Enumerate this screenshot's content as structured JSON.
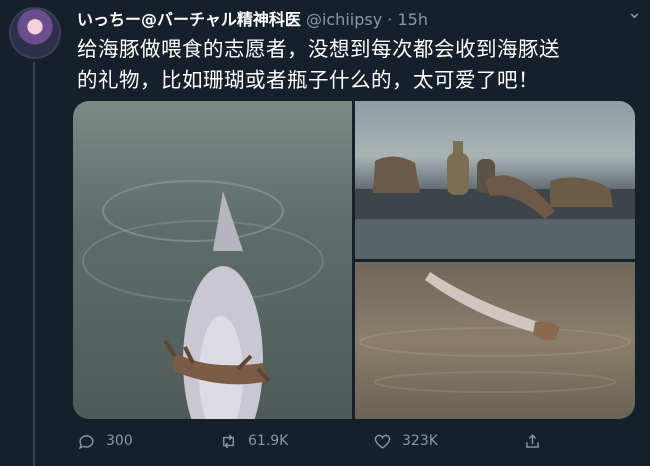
{
  "author": {
    "name": "いっちー@バーチャル精神科医",
    "handle": "@ichiipsy",
    "separator": "·",
    "time": "15h"
  },
  "tweet": {
    "line1": "给海豚做喂食的志愿者，没想到每次都会收到海豚送",
    "line2": "的礼物，比如珊瑚或者瓶子什么的，太可爱了吧！"
  },
  "media": [
    {
      "icon": "dolphin-with-coral-photo"
    },
    {
      "icon": "gifts-on-pier-photo"
    },
    {
      "icon": "dolphin-carrying-coral-photo"
    }
  ],
  "actions": {
    "reply_count": "300",
    "retweet_count": "61.9K",
    "like_count": "323K"
  },
  "colors": {
    "background": "#15202b",
    "secondary_text": "#8899a6",
    "primary_text": "#ffffff",
    "thread_line": "#38444d"
  }
}
